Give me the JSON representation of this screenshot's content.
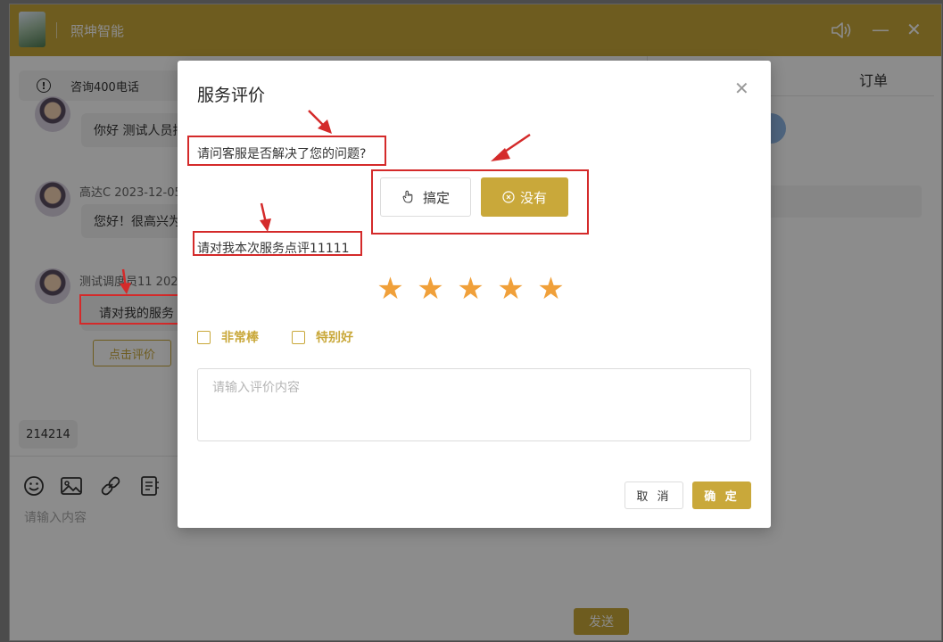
{
  "app": {
    "title": "照坤智能",
    "volume_icon": "volume-icon",
    "minimize_glyph": "—",
    "close_glyph": "✕"
  },
  "chat": {
    "notice": {
      "icon": "info-icon",
      "text": "咨询400电话"
    },
    "messages": [
      {
        "text": "你好 测试人员押"
      },
      {
        "sender_time": "高达C 2023-12-05",
        "text": "您好！很高兴为"
      },
      {
        "sender_time": "测试调度员11 2023",
        "text": "请对我的服务",
        "button": "点击评价"
      }
    ],
    "chip": "214214",
    "toolbar": [
      "emoji-icon",
      "image-icon",
      "link-icon",
      "template-icon"
    ],
    "input_placeholder": "请输入内容",
    "send": "发送"
  },
  "sidebar": {
    "tab_orders": "订单"
  },
  "dialog": {
    "title": "服务评价",
    "close_icon": "close-icon",
    "question_resolved": "请问客服是否解决了您的问题?",
    "btn_resolved": "搞定",
    "btn_not_resolved": "没有",
    "question_rate": "请对我本次服务点评11111",
    "rating": {
      "value": 5,
      "max": 5
    },
    "tags": [
      {
        "label": "非常棒",
        "checked": false
      },
      {
        "label": "特别好",
        "checked": false
      }
    ],
    "comment_placeholder": "请输入评价内容",
    "cancel": "取 消",
    "confirm": "确 定"
  },
  "colors": {
    "brand": "#c9a83a",
    "star": "#f0a03a",
    "annotation": "#d42a2a"
  }
}
